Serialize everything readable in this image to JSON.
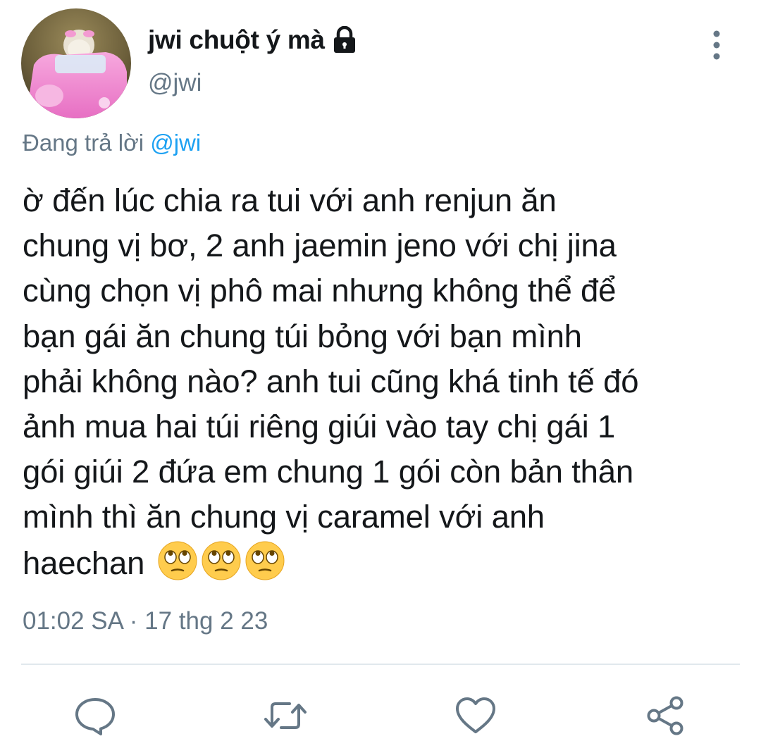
{
  "author": {
    "display_name": "jwi chuột ý mà",
    "handle": "@jwi",
    "protected_icon": "lock-icon"
  },
  "reply_context": {
    "prefix": "Đang trả lời",
    "handle": "@jwi"
  },
  "tweet": {
    "lines": [
      "ờ đến lúc chia ra tui với anh renjun ăn",
      "chung vị bơ, 2 anh jaemin jeno với chị jina",
      "cùng chọn vị phô mai nhưng không thể để",
      "bạn gái ăn chung túi bỏng với bạn mình",
      "phải không nào? anh tui cũng khá tinh tế đó",
      "ảnh mua hai túi riêng giúi vào tay chị gái 1",
      "gói giúi 2 đứa em chung 1 gói còn bản thân",
      "mình thì ăn chung vị caramel với anh",
      "haechan"
    ],
    "emojis": [
      "face-with-rolling-eyes",
      "face-with-rolling-eyes",
      "face-with-rolling-eyes"
    ],
    "timestamp": "01:02 SA · 17 thg 2 23"
  },
  "actions": [
    "reply-icon",
    "retweet-icon",
    "like-icon",
    "share-icon"
  ],
  "colors": {
    "text": "#14171a",
    "secondary": "#657786",
    "link": "#1da1f2",
    "divider": "#e1e8ed"
  }
}
